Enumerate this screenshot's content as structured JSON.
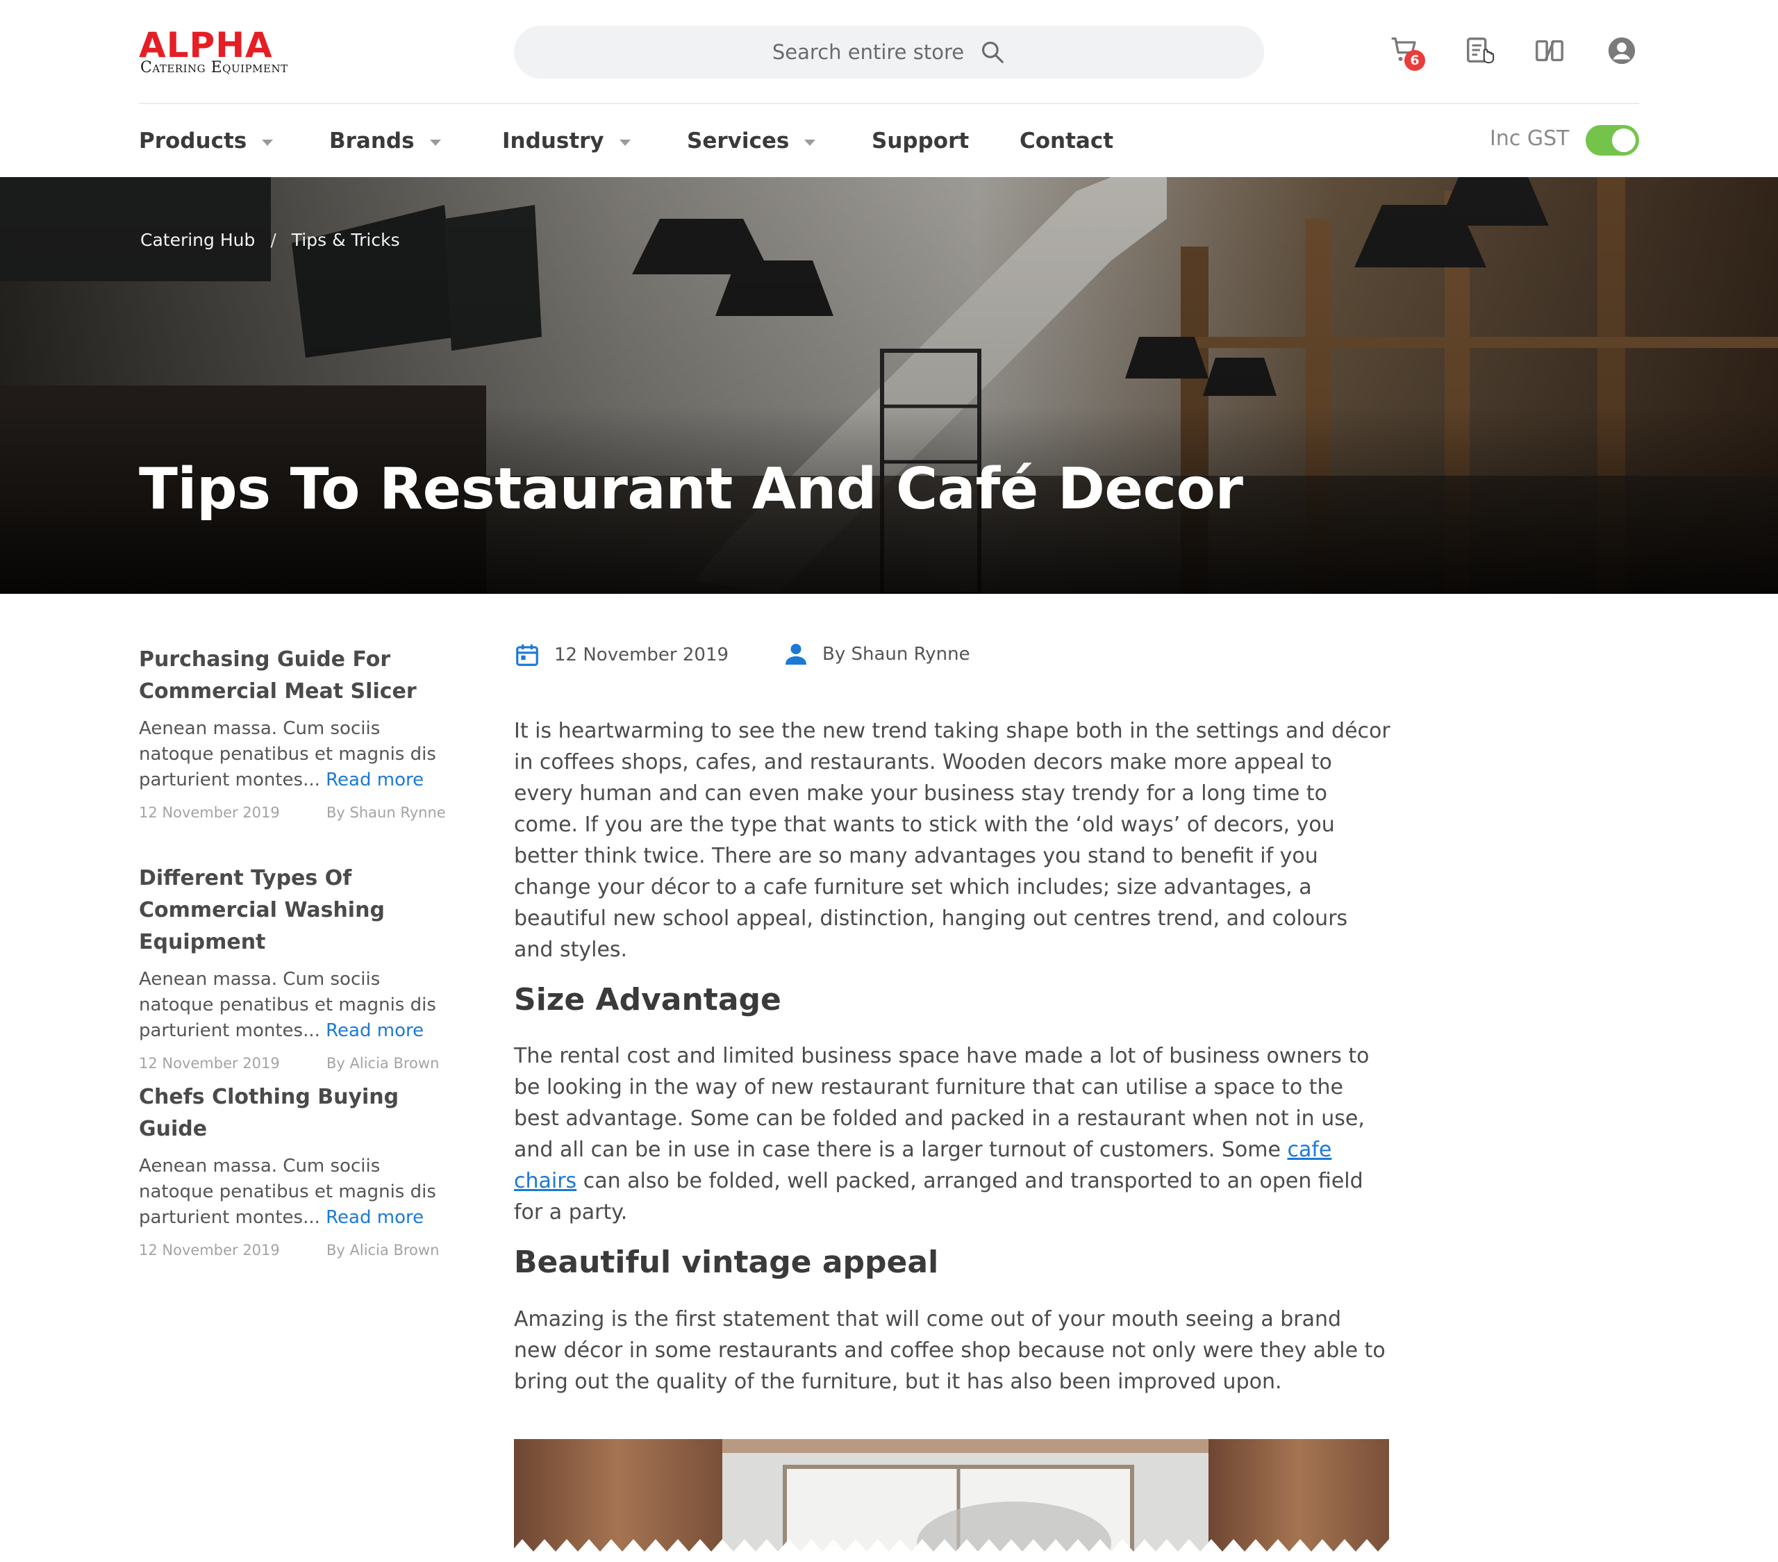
{
  "brand": {
    "name": "ALPHA",
    "tagline": "Catering Equipment",
    "color": "#e51e25"
  },
  "search": {
    "placeholder": "Search entire store",
    "icon": "search-icon"
  },
  "header_icons": {
    "cart_icon": "cart-icon",
    "cart_count": "6",
    "quote_icon": "quote-list-icon",
    "compare_icon": "compare-icon",
    "account_icon": "account-icon"
  },
  "nav": {
    "items": [
      {
        "label": "Products",
        "has_dropdown": true
      },
      {
        "label": "Brands",
        "has_dropdown": true
      },
      {
        "label": "Industry",
        "has_dropdown": true
      },
      {
        "label": "Services",
        "has_dropdown": true
      },
      {
        "label": "Support",
        "has_dropdown": false
      },
      {
        "label": "Contact",
        "has_dropdown": false
      }
    ],
    "gst_label": "Inc GST",
    "gst_enabled": true,
    "toggle_color": "#74c44c"
  },
  "hero": {
    "breadcrumb": [
      {
        "label": "Catering Hub"
      },
      {
        "label": "Tips & Tricks"
      }
    ],
    "breadcrumb_separator": "/",
    "title": "Tips To Restaurant And Café Decor"
  },
  "sidebar": {
    "read_more_label": "Read more",
    "posts": [
      {
        "title": "Purchasing Guide For Commercial Meat Slicer",
        "excerpt": "Aenean massa. Cum sociis natoque penatibus et magnis dis parturient montes... ",
        "date": "12 November 2019",
        "author": "By Shaun Rynne"
      },
      {
        "title": "Different Types Of Commercial Washing Equipment",
        "excerpt": "Aenean massa. Cum sociis natoque penatibus et magnis dis parturient montes... ",
        "date": "12 November 2019",
        "author": "By Alicia Brown"
      },
      {
        "title": "Chefs Clothing Buying Guide",
        "excerpt": "Aenean massa. Cum sociis natoque penatibus et magnis dis parturient montes... ",
        "date": "12 November 2019",
        "author": "By Alicia Brown"
      }
    ]
  },
  "article": {
    "date": "12 November 2019",
    "date_icon": "calendar-icon",
    "author": "By Shaun Rynne",
    "author_icon": "user-icon",
    "accent_color": "#1c79d6",
    "intro": "It is heartwarming to see the new trend taking shape both in the settings and décor in coffees shops, cafes, and restaurants. Wooden decors make more appeal to every human and can even make your business stay trendy for a long time to come. If you are the type that wants to stick with the ‘old ways’ of decors, you better think twice. There are so many advantages you stand to benefit if you change your décor to a cafe furniture set which includes; size advantages, a beautiful new school appeal, distinction, hanging out centres trend, and colours and styles.",
    "section1": {
      "heading": "Size Advantage",
      "text_before_link": "The rental cost and limited business space have made a lot of business owners to be looking in the way of new restaurant furniture that can utilise a space to the best advantage. Some can be folded and packed in a restaurant when not in use, and all can be in use in case there is a larger turnout of customers. Some ",
      "link_text": "cafe chairs",
      "text_after_link": " can also be folded, well packed, arranged and transported to an open field for a party."
    },
    "section2": {
      "heading": "Beautiful vintage appeal",
      "text": "Amazing is the first statement that will come out of your mouth seeing a brand new décor in some restaurants and coffee shop because not only were they able to bring out the quality of the furniture, but it has also been improved upon."
    }
  }
}
